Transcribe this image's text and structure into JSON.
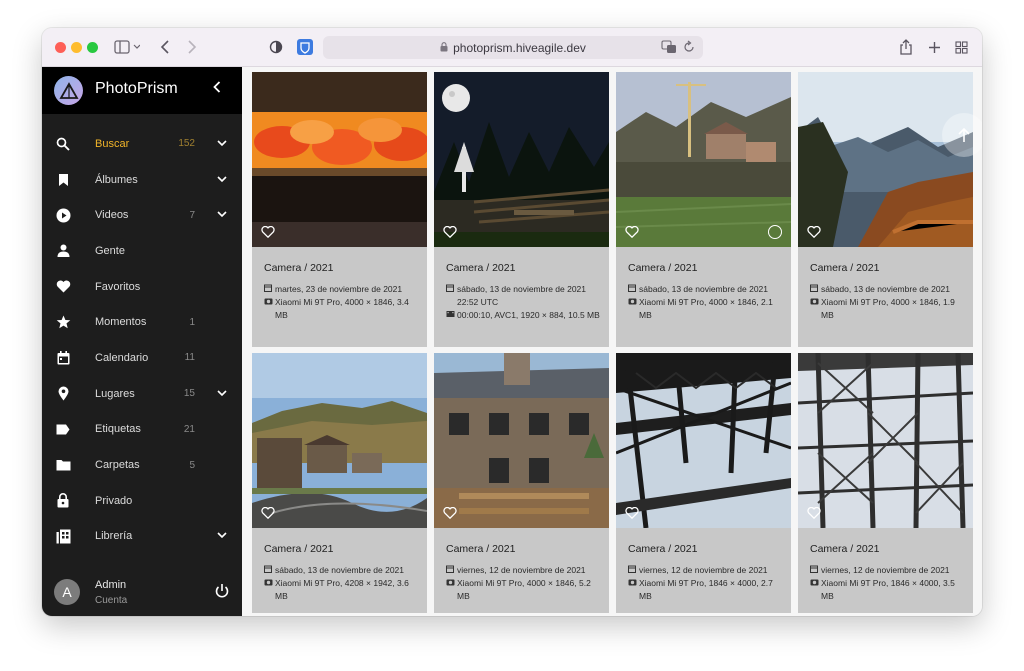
{
  "browser": {
    "url": "photoprism.hiveagile.dev",
    "colors": {
      "close": "#fe5f57",
      "minimize": "#febc2e",
      "zoom": "#28c840"
    }
  },
  "sidebar": {
    "brand": "PhotoPrism",
    "items": [
      {
        "label": "Buscar",
        "count": "152",
        "icon": "search-icon",
        "expand": true,
        "active": true
      },
      {
        "label": "Álbumes",
        "count": "",
        "icon": "bookmark-icon",
        "expand": true
      },
      {
        "label": "Videos",
        "count": "7",
        "icon": "play-icon",
        "expand": true
      },
      {
        "label": "Gente",
        "count": "",
        "icon": "person-icon",
        "expand": false
      },
      {
        "label": "Favoritos",
        "count": "",
        "icon": "heart-icon",
        "expand": false
      },
      {
        "label": "Momentos",
        "count": "1",
        "icon": "star-icon",
        "expand": false
      },
      {
        "label": "Calendario",
        "count": "11",
        "icon": "calendar-icon",
        "expand": false
      },
      {
        "label": "Lugares",
        "count": "15",
        "icon": "location-pin-icon",
        "expand": true
      },
      {
        "label": "Etiquetas",
        "count": "21",
        "icon": "label-icon",
        "expand": false
      },
      {
        "label": "Carpetas",
        "count": "5",
        "icon": "folder-icon",
        "expand": false
      },
      {
        "label": "Privado",
        "count": "",
        "icon": "lock-icon",
        "expand": false
      },
      {
        "label": "Librería",
        "count": "",
        "icon": "library-icon",
        "expand": true
      }
    ],
    "account": {
      "initial": "A",
      "name": "Admin",
      "sub": "Cuenta"
    },
    "accent": "#f0b429"
  },
  "photos": [
    {
      "title": "Camera / 2021",
      "date": "martes, 23 de noviembre de 2021",
      "camera": "Xiaomi Mi 9T Pro, 4000 × 1846, 3.4 MB",
      "video": "",
      "scene": "oven"
    },
    {
      "title": "Camera / 2021",
      "date": "sábado, 13 de noviembre de 2021 22:52 UTC",
      "camera": "",
      "video": "00:00:10, AVC1, 1920 × 884, 10.5 MB",
      "scene": "night"
    },
    {
      "title": "Camera / 2021",
      "date": "sábado, 13 de noviembre de 2021",
      "camera": "Xiaomi Mi 9T Pro, 4000 × 1846, 2.1 MB",
      "video": "",
      "scene": "village"
    },
    {
      "title": "Camera / 2021",
      "date": "sábado, 13 de noviembre de 2021",
      "camera": "Xiaomi Mi 9T Pro, 4000 × 1846, 1.9 MB",
      "video": "",
      "scene": "mountains"
    },
    {
      "title": "Camera / 2021",
      "date": "sábado, 13 de noviembre de 2021",
      "camera": "Xiaomi Mi 9T Pro, 4208 × 1942, 3.6 MB",
      "video": "",
      "scene": "town"
    },
    {
      "title": "Camera / 2021",
      "date": "viernes, 12 de noviembre de 2021",
      "camera": "Xiaomi Mi 9T Pro, 4000 × 1846, 5.2 MB",
      "video": "",
      "scene": "stonehouse"
    },
    {
      "title": "Camera / 2021",
      "date": "viernes, 12 de noviembre de 2021",
      "camera": "Xiaomi Mi 9T Pro, 1846 × 4000, 2.7 MB",
      "video": "",
      "scene": "structure"
    },
    {
      "title": "Camera / 2021",
      "date": "viernes, 12 de noviembre de 2021",
      "camera": "Xiaomi Mi 9T Pro, 1846 × 4000, 3.5 MB",
      "video": "",
      "scene": "towers"
    }
  ]
}
